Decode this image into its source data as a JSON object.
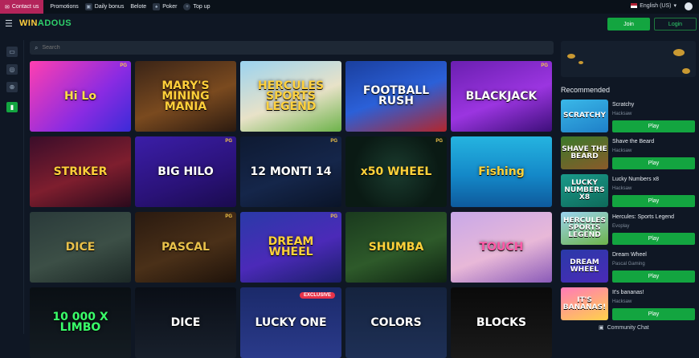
{
  "topbar": {
    "contact": "Contact us",
    "links": [
      {
        "label": "Promotions"
      },
      {
        "label": "Daily bonus"
      },
      {
        "label": "Belote"
      },
      {
        "label": "Poker"
      },
      {
        "label": "Top up"
      }
    ],
    "language": "English (US)"
  },
  "header": {
    "logo": "WIN",
    "logo2": "ADOUS",
    "join": "Join",
    "login": "Login"
  },
  "search": {
    "placeholder": "Search"
  },
  "games": [
    {
      "title": "Hi Lo",
      "bg": "linear-gradient(135deg,#ff3fb0,#8a2be2 60%,#3b2bd8)",
      "color": "#ffe04a"
    },
    {
      "title": "MARY'S MINING MANIA",
      "bg": "linear-gradient(160deg,#3a2417,#7a4a1f 55%,#2b1a10)",
      "color": "#ffcf3a"
    },
    {
      "title": "HERCULES SPORTS LEGEND",
      "bg": "linear-gradient(160deg,#9bd3f0,#e8e2c8 55%,#6db34a)",
      "color": "#ffd23f"
    },
    {
      "title": "FOOTBALL RUSH",
      "bg": "linear-gradient(160deg,#1a3f9e,#2b60d8 50%,#b3262c)",
      "color": "#ffffff"
    },
    {
      "title": "BLACKJACK",
      "bg": "linear-gradient(160deg,#6a1fb0,#9b35e0 55%,#3d0f7a)",
      "color": "#ffffff"
    },
    {
      "title": "STRIKER",
      "bg": "linear-gradient(160deg,#3a0d2a,#7e1e2e 55%,#2a0a1c)",
      "color": "#ffce3a"
    },
    {
      "title": "BIG HILO",
      "bg": "linear-gradient(160deg,#3b1ea8,#2a1278 60%,#1a0b4e)",
      "color": "#ffffff"
    },
    {
      "title": "12 MONTI 14",
      "bg": "linear-gradient(160deg,#0e1a32,#15264a 55%,#0a1428)",
      "color": "#ffffff"
    },
    {
      "title": "x50 WHEEL",
      "bg": "radial-gradient(circle,#1a3b2e,#0a1a14 70%)",
      "color": "#ffd23a"
    },
    {
      "title": "Fishing",
      "bg": "linear-gradient(180deg,#25b4e0,#1488c8 55%,#0e5a9c)",
      "color": "#ffd23a"
    },
    {
      "title": "DICE",
      "bg": "linear-gradient(160deg,#2a3a3a,#3c4f46 55%,#1c2826)",
      "color": "#e8c04a"
    },
    {
      "title": "PASCAL",
      "bg": "linear-gradient(160deg,#2a1a10,#4a3018 55%,#1e120a)",
      "color": "#e8c04a"
    },
    {
      "title": "DREAM WHEEL",
      "bg": "linear-gradient(160deg,#2a3aa8,#4b2ab8 55%,#1b1e6a)",
      "color": "#ffd23a"
    },
    {
      "title": "SHUMBA",
      "bg": "linear-gradient(160deg,#1a3a1e,#2e5a2a 55%,#0e2212)",
      "color": "#ffd23a"
    },
    {
      "title": "TOUCH",
      "bg": "linear-gradient(160deg,#c8a8e8,#e8b8d8 55%,#8a5ab8)",
      "color": "#ff5aa8"
    },
    {
      "title": "10 000 X LIMBO",
      "bg": "linear-gradient(180deg,#0a0f14,#141c22)",
      "color": "#3aff6a"
    },
    {
      "title": "DICE",
      "bg": "linear-gradient(180deg,#0a0e16,#18202c)",
      "color": "#ffffff"
    },
    {
      "title": "LUCKY ONE",
      "bg": "linear-gradient(180deg,#1b2a6a,#2a3a8a)",
      "color": "#ffffff"
    },
    {
      "title": "COLORS",
      "bg": "linear-gradient(180deg,#15233e,#1e3056)",
      "color": "#ffffff"
    },
    {
      "title": "BLOCKS",
      "bg": "linear-gradient(180deg,#0a0a0a,#1a1a1a)",
      "color": "#ffffff"
    }
  ],
  "badges": {
    "pg": "PG",
    "exclusive": "EXCLUSIVE"
  },
  "recommended": {
    "title": "Recommended",
    "play": "Play",
    "items": [
      {
        "name": "Scratchy",
        "provider": "Hacksaw",
        "thumb": "SCRATCHY",
        "bg": "linear-gradient(160deg,#3ab8e8,#1e7fc8)"
      },
      {
        "name": "Shave the Beard",
        "provider": "Hacksaw",
        "thumb": "SHAVE THE BEARD",
        "bg": "linear-gradient(160deg,#3a7a2a,#8a5a2a)"
      },
      {
        "name": "Lucky Numbers x8",
        "provider": "Hacksaw",
        "thumb": "LUCKY NUMBERS X8",
        "bg": "linear-gradient(160deg,#1a9a8a,#0e6a5a)"
      },
      {
        "name": "Hercules: Sports Legend",
        "provider": "Evoplay",
        "thumb": "HERCULES SPORTS LEGEND",
        "bg": "linear-gradient(160deg,#9bd3f0,#6db34a)"
      },
      {
        "name": "Dream Wheel",
        "provider": "Pascal Gaming",
        "thumb": "DREAM WHEEL",
        "bg": "linear-gradient(160deg,#2a3aa8,#4b2ab8)"
      },
      {
        "name": "It's bananas!",
        "provider": "Hacksaw",
        "thumb": "IT'S BANANAS!",
        "bg": "linear-gradient(160deg,#ff7ab8,#ffd24a)"
      }
    ]
  },
  "chat": "Community Chat"
}
